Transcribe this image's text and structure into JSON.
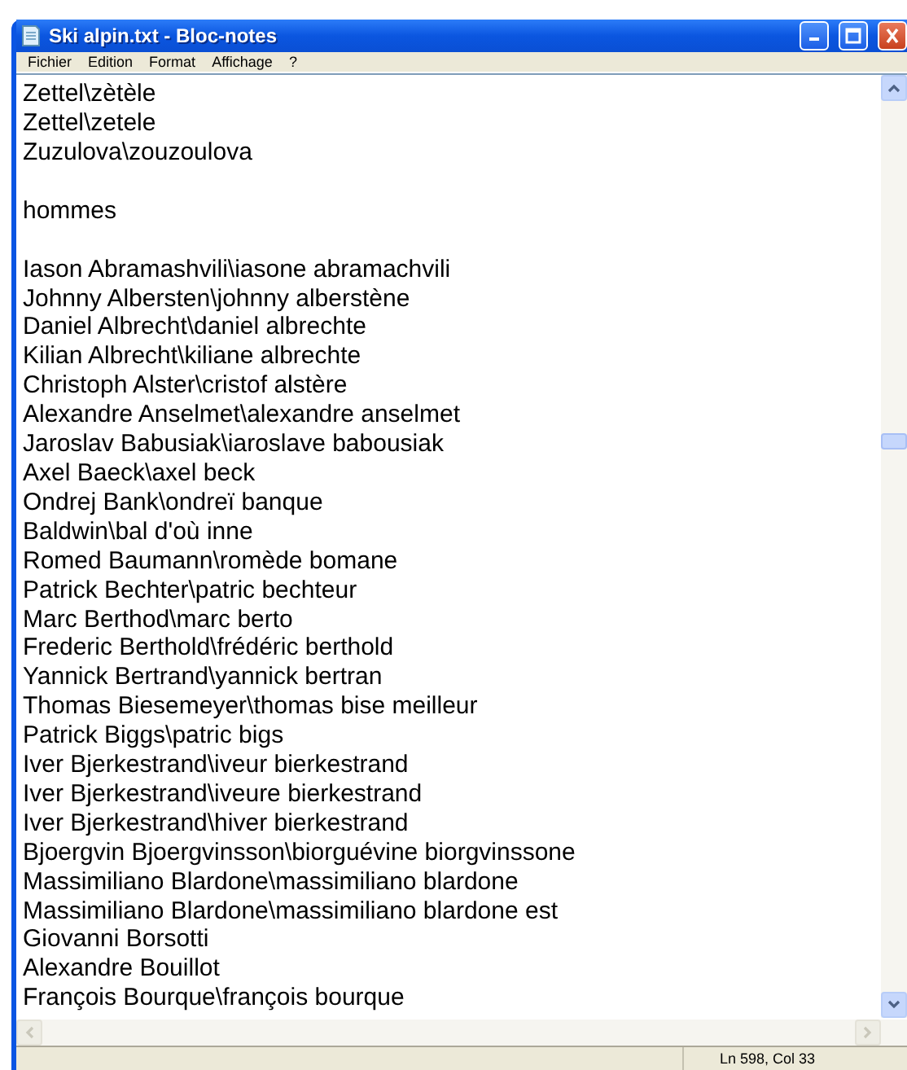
{
  "window": {
    "title": "Ski alpin.txt - Bloc-notes"
  },
  "menu": [
    "Fichier",
    "Edition",
    "Format",
    "Affichage",
    "?"
  ],
  "blocks": [
    {
      "lines": [
        "Zettel\\zètèle",
        "Zettel\\zetele",
        "Zuzulova\\zouzoulova"
      ]
    },
    {
      "lines": [
        "hommes"
      ]
    },
    {
      "lines": [
        "Iason Abramashvili\\iasone abramachvili",
        "Johnny Albersten\\johnny alberstène",
        "Daniel Albrecht\\daniel albrechte",
        "Kilian Albrecht\\kiliane albrechte",
        "Christoph Alster\\cristof alstère",
        "Alexandre Anselmet\\alexandre anselmet",
        "Jaroslav Babusiak\\iaroslave babousiak",
        "Axel Baeck\\axel beck",
        "Ondrej Bank\\ondreï banque",
        "Baldwin\\bal d'où inne",
        "Romed Baumann\\romède bomane",
        "Patrick Bechter\\patric bechteur",
        "Marc Berthod\\marc berto",
        "Frederic Berthold\\frédéric berthold",
        "Yannick Bertrand\\yannick bertran",
        "Thomas Biesemeyer\\thomas bise meilleur",
        "Patrick Biggs\\patric bigs",
        "Iver Bjerkestrand\\iveur bierkestrand",
        "Iver Bjerkestrand\\iveure bierkestrand",
        "Iver Bjerkestrand\\hiver bierkestrand",
        "Bjoergvin Bjoergvinsson\\biorguévine biorgvinssone",
        "Massimiliano Blardone\\massimiliano blardone",
        "Massimiliano Blardone\\massimiliano blardone est",
        "Giovanni Borsotti",
        "Alexandre Bouillot",
        "François Bourque\\françois bourque"
      ]
    }
  ],
  "status_bar": {
    "position": "Ln 598, Col 33"
  }
}
